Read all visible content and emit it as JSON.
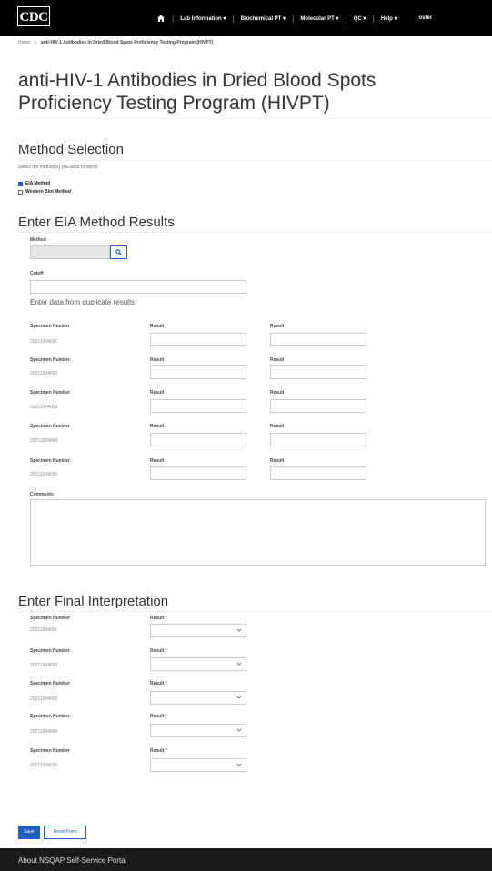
{
  "header": {
    "logo": "CDC",
    "nav": [
      "Lab Information ▾",
      "Biochemical PT ▾",
      "Molecular PT ▾",
      "QC ▾",
      "Help ▾"
    ],
    "user": "oster"
  },
  "breadcrumb": {
    "home": "Home",
    "separator": "»",
    "current": "anti-HIV-1 Antibodies in Dried Blood Spots Proficiency Testing Program (HIVPT)"
  },
  "page_title": "anti-HIV-1 Antibodies in Dried Blood Spots Proficiency Testing Program (HIVPT)",
  "method_selection": {
    "title": "Method Selection",
    "instruction": "Select the method(s) you want to report",
    "options": [
      {
        "label": "EIA Method",
        "checked": true
      },
      {
        "label": "Western Blot Method",
        "checked": false
      }
    ]
  },
  "eia": {
    "title": "Enter EIA Method Results",
    "method_label": "Method",
    "method_value": "",
    "cutoff_label": "Cutoff",
    "cutoff_value": "",
    "duplicate_note": "Enter data from duplicate results",
    "specimen_label": "Specimen Number",
    "result_label": "Result",
    "rows": [
      {
        "specimen": "20211004001",
        "result1": "",
        "result2": ""
      },
      {
        "specimen": "20211004002",
        "result1": "",
        "result2": ""
      },
      {
        "specimen": "20211004003",
        "result1": "",
        "result2": ""
      },
      {
        "specimen": "20211004004",
        "result1": "",
        "result2": ""
      },
      {
        "specimen": "20211004005",
        "result1": "",
        "result2": ""
      }
    ],
    "comments_label": "Comments",
    "comments_value": ""
  },
  "final": {
    "title": "Enter Final Interpretation",
    "specimen_label": "Specimen Number",
    "result_label": "Result *",
    "rows": [
      {
        "specimen": "20211004001",
        "selected": ""
      },
      {
        "specimen": "20211004002",
        "selected": ""
      },
      {
        "specimen": "20211004003",
        "selected": ""
      },
      {
        "specimen": "20211004004",
        "selected": ""
      },
      {
        "specimen": "20211004005",
        "selected": ""
      }
    ]
  },
  "actions": {
    "save": "Save",
    "reset": "Reset Form"
  },
  "footer": {
    "text": "About NSQAP Self-Service Portal"
  },
  "colors": {
    "accent": "#1f5fbf",
    "topbar": "#000000",
    "footer": "#1b1b1b"
  }
}
